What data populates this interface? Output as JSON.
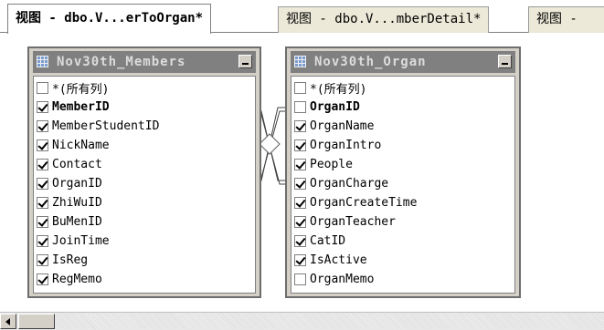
{
  "tabs": [
    {
      "label": "视图 - dbo.V...erToOrgan*",
      "active": true
    },
    {
      "label": "视图 - dbo.V...mberDetail*",
      "active": false
    },
    {
      "label": "视图 -",
      "active": false
    }
  ],
  "tables": [
    {
      "title": "Nov30th_Members",
      "columns": [
        {
          "name": "*(所有列)",
          "checked": false,
          "key": false
        },
        {
          "name": "MemberID",
          "checked": true,
          "key": true
        },
        {
          "name": "MemberStudentID",
          "checked": true,
          "key": false
        },
        {
          "name": "NickName",
          "checked": true,
          "key": false
        },
        {
          "name": "Contact",
          "checked": true,
          "key": false
        },
        {
          "name": "OrganID",
          "checked": true,
          "key": false
        },
        {
          "name": "ZhiWuID",
          "checked": true,
          "key": false
        },
        {
          "name": "BuMenID",
          "checked": true,
          "key": false
        },
        {
          "name": "JoinTime",
          "checked": true,
          "key": false
        },
        {
          "name": "IsReg",
          "checked": true,
          "key": false
        },
        {
          "name": "RegMemo",
          "checked": true,
          "key": false
        }
      ]
    },
    {
      "title": "Nov30th_Organ",
      "columns": [
        {
          "name": "*(所有列)",
          "checked": false,
          "key": false
        },
        {
          "name": "OrganID",
          "checked": false,
          "key": true
        },
        {
          "name": "OrganName",
          "checked": true,
          "key": false
        },
        {
          "name": "OrganIntro",
          "checked": true,
          "key": false
        },
        {
          "name": "People",
          "checked": true,
          "key": false
        },
        {
          "name": "OrganCharge",
          "checked": true,
          "key": false
        },
        {
          "name": "OrganCreateTime",
          "checked": true,
          "key": false
        },
        {
          "name": "OrganTeacher",
          "checked": true,
          "key": false
        },
        {
          "name": "CatID",
          "checked": true,
          "key": false
        },
        {
          "name": "IsActive",
          "checked": true,
          "key": false
        },
        {
          "name": "OrganMemo",
          "checked": false,
          "key": false
        }
      ]
    }
  ]
}
